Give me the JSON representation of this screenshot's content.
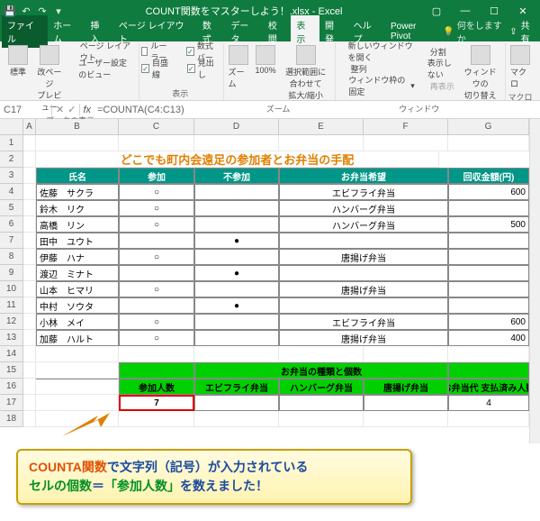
{
  "title": "COUNT関数をマスターしよう！.xlsx - Excel",
  "menubar": {
    "file": "ファイル",
    "tabs": [
      "ホーム",
      "挿入",
      "ページ レイアウト",
      "数式",
      "データ",
      "校閲",
      "表示",
      "開発",
      "ヘルプ",
      "Power Pivot"
    ],
    "active": "表示",
    "tell": "何をしますか",
    "share": "共有"
  },
  "ribbon": {
    "views": {
      "normal": "標準",
      "pbprev": "改ページ\nプレビュー",
      "pagelayout": "ページ レイアウト",
      "userview": "ユーザー設定のビュー",
      "group": "ブックの表示"
    },
    "show": {
      "ruler": "ルーラー",
      "fbar": "数式バー",
      "grid": "目盛線",
      "head": "見出し",
      "group": "表示"
    },
    "zoom": {
      "zoom": "ズーム",
      "z100": "100%",
      "zsel": "選択範囲に合わせて\n拡大/縮小",
      "group": "ズーム"
    },
    "window": {
      "new": "新しいウィンドウを開く",
      "arr": "整列",
      "freeze": "ウィンドウ枠の固定",
      "split": "分割",
      "hide": "表示しない",
      "unhide": "再表示",
      "switch": "ウィンドウの\n切り替え",
      "group": "ウィンドウ"
    },
    "macro": {
      "macro": "マクロ",
      "group": "マクロ"
    }
  },
  "namebox": "C17",
  "formula": "=COUNTA(C4:C13)",
  "cols": [
    "A",
    "B",
    "C",
    "D",
    "E",
    "F",
    "G"
  ],
  "sheet_title": "どこでも町内会遠足の参加者とお弁当の手配",
  "headers": {
    "name": "氏名",
    "attend": "参加",
    "absent": "不参加",
    "bento": "お弁当希望",
    "amount": "回収金額(円)"
  },
  "rows": [
    {
      "n": "佐藤　サクラ",
      "a": "○",
      "x": "",
      "b": "エビフライ弁当",
      "y": "600"
    },
    {
      "n": "鈴木　リク",
      "a": "○",
      "x": "",
      "b": "ハンバーグ弁当",
      "y": ""
    },
    {
      "n": "高橋　リン",
      "a": "○",
      "x": "",
      "b": "ハンバーグ弁当",
      "y": "500"
    },
    {
      "n": "田中　ユウト",
      "a": "",
      "x": "●",
      "b": "",
      "y": ""
    },
    {
      "n": "伊藤　ハナ",
      "a": "○",
      "x": "",
      "b": "唐揚げ弁当",
      "y": ""
    },
    {
      "n": "渡辺　ミナト",
      "a": "",
      "x": "●",
      "b": "",
      "y": ""
    },
    {
      "n": "山本　ヒマリ",
      "a": "○",
      "x": "",
      "b": "唐揚げ弁当",
      "y": ""
    },
    {
      "n": "中村　ソウタ",
      "a": "",
      "x": "●",
      "b": "",
      "y": ""
    },
    {
      "n": "小林　メイ",
      "a": "○",
      "x": "",
      "b": "エビフライ弁当",
      "y": "600"
    },
    {
      "n": "加藤　ハルト",
      "a": "○",
      "x": "",
      "b": "唐揚げ弁当",
      "y": "400"
    }
  ],
  "summary": {
    "attend_label": "参加人数",
    "bento_type_label": "お弁当の種類と個数",
    "ebi": "エビフライ弁当",
    "ham": "ハンバーグ弁当",
    "kara": "唐揚げ弁当",
    "paid_label": "お弁当代\n支払済み人数",
    "attend_count": "7",
    "paid_count": "4"
  },
  "callout": {
    "l1a": "COUNTA関数",
    "l1b": "で",
    "l1c": "文字列（記号）が入力されている",
    "l2a": "セルの個数",
    "l2b": "＝",
    "l2c": "「参加人数」",
    "l2d": "を数えました！"
  }
}
